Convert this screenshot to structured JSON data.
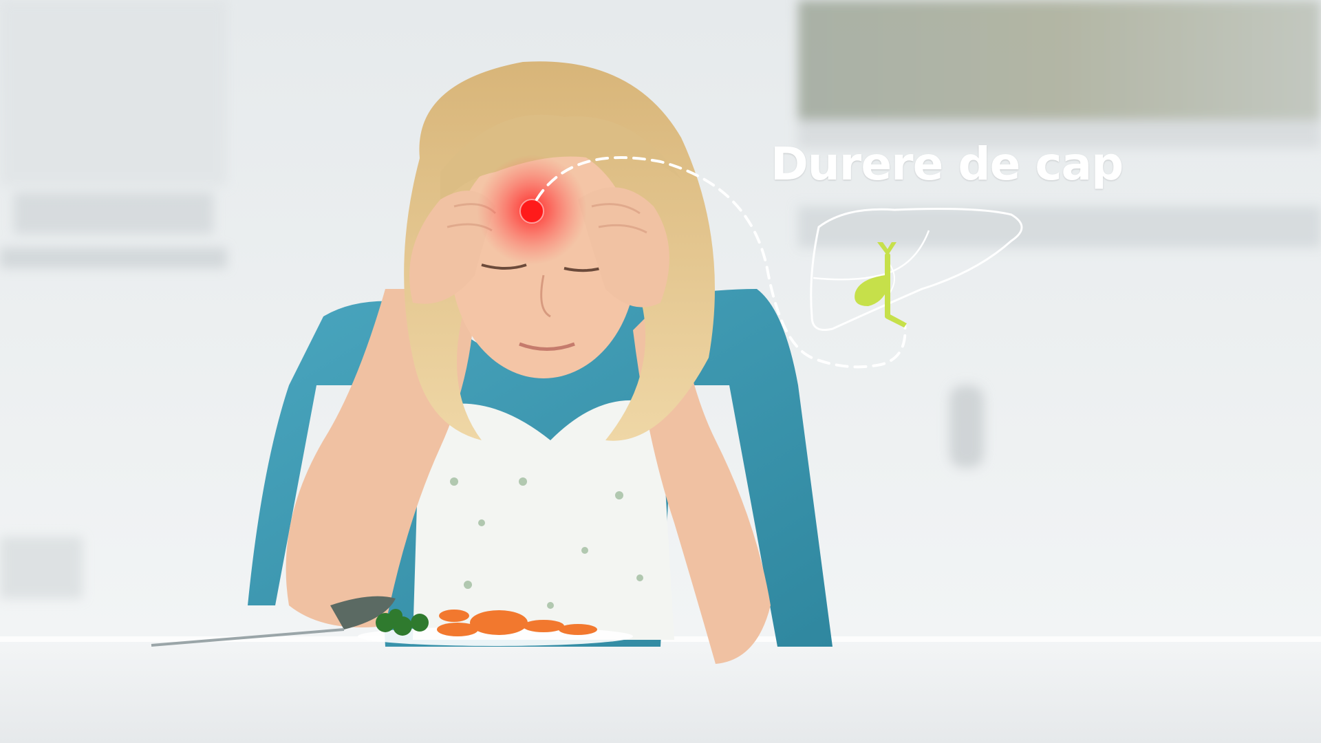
{
  "caption": {
    "title": "Durere de cap"
  },
  "colors": {
    "pain_red": "#ff1a1a",
    "liver_outline": "#ffffff",
    "gallbladder": "#c6e04a",
    "shirt": "#3f9bb5",
    "hair": "#e3c48a",
    "skin": "#f2c3a4",
    "background": "#eef1f3"
  },
  "icons": {
    "liver": "liver-outline-icon",
    "gallbladder": "gallbladder-icon",
    "pain_point": "pain-point-icon"
  }
}
